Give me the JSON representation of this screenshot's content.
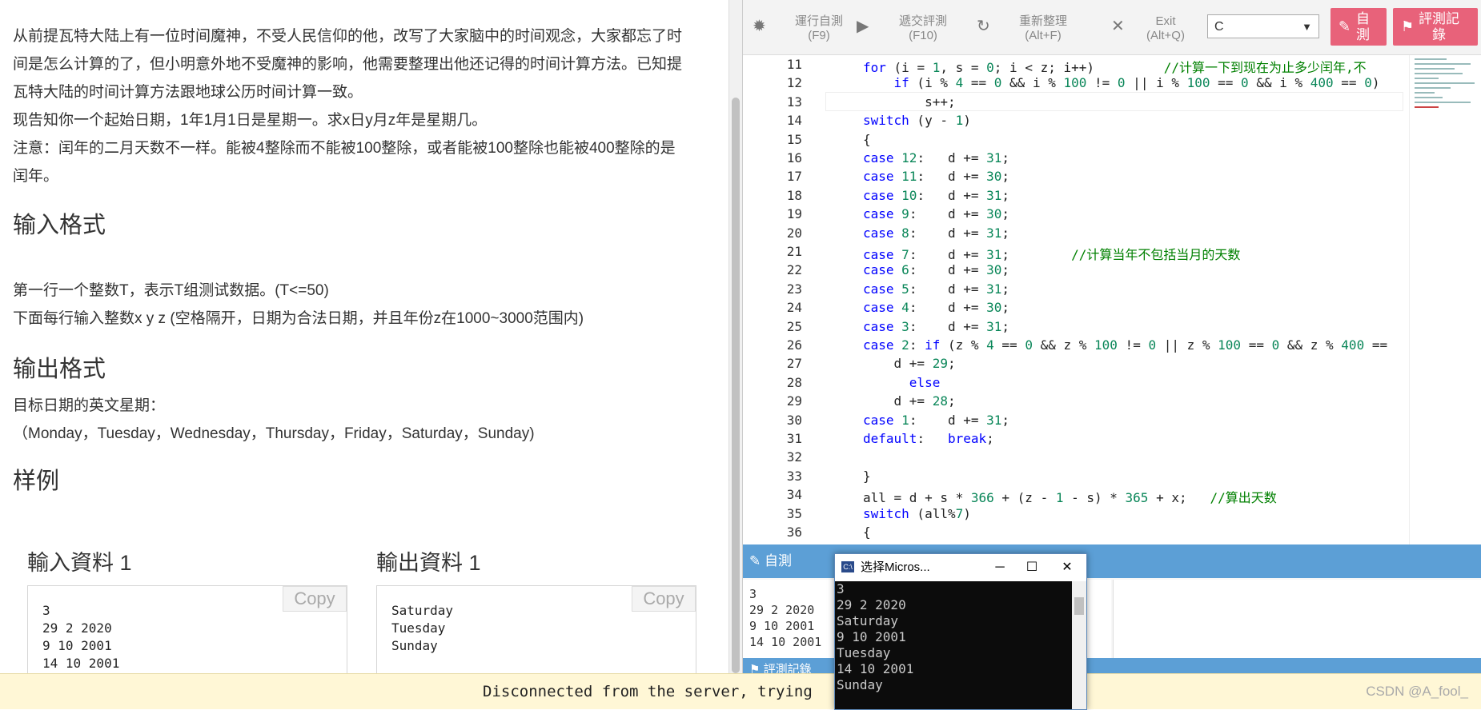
{
  "problem": {
    "paragraphs": [
      "从前提瓦特大陆上有一位时间魔神，不受人民信仰的他，改写了大家脑中的时间观念，大家都忘了时",
      "间是怎么计算的了，但小明意外地不受魔神的影响，他需要整理出他还记得的时间计算方法。已知提",
      "瓦特大陆的时间计算方法跟地球公历时间计算一致。",
      "现告知你一个起始日期，1年1月1日是星期一。求x日y月z年是星期几。",
      "注意：闰年的二月天数不一样。能被4整除而不能被100整除，或者能被100整除也能被400整除的是",
      "闰年。"
    ],
    "input_heading": "输入格式",
    "input_lines": [
      "第一行一个整数T，表示T组测试数据。(T<=50)",
      "下面每行输入整数x y z (空格隔开，日期为合法日期，并且年份z在1000~3000范围内)"
    ],
    "output_heading": "输出格式",
    "output_lines": [
      "目标日期的英文星期：",
      "（Monday，Tuesday，Wednesday，Thursday，Friday，Saturday，Sunday)"
    ],
    "sample_heading": "样例",
    "sample_input_title": "輸入資料 1",
    "sample_output_title": "輸出資料 1",
    "copy_label": "Copy",
    "sample_input": "3\n29 2 2020\n9 10 2001\n14 10 2001",
    "sample_output": "Saturday\nTuesday\nSunday"
  },
  "toolbar": {
    "run_label": "運行自測",
    "run_key": "(F9)",
    "submit_label": "遞交評測",
    "submit_key": "(F10)",
    "format_label": "重新整理",
    "format_key": "(Alt+F)",
    "exit_label": "Exit",
    "exit_key": "(Alt+Q)",
    "language": "C",
    "self_test_label_1": "自",
    "self_test_label_2": "測",
    "record_label_1": "評測記",
    "record_label_2": "錄"
  },
  "editor": {
    "line_numbers": [
      "11",
      "12",
      "13",
      "14",
      "15",
      "16",
      "17",
      "18",
      "19",
      "20",
      "21",
      "22",
      "23",
      "24",
      "25",
      "26",
      "27",
      "28",
      "29",
      "30",
      "31",
      "32",
      "33",
      "34",
      "35",
      "36"
    ]
  },
  "selftest": {
    "header": "自測",
    "input": "3\n29 2 2020\n9 10 2001\n14 10 2001",
    "history_label": "評測記錄"
  },
  "banner": {
    "text": "Disconnected from the server, trying"
  },
  "console": {
    "title": "选择Micros...",
    "output": "3\n29 2 2020\nSaturday\n9 10 2001\nTuesday\n14 10 2001\nSunday "
  },
  "watermark": "CSDN @A_fool_",
  "colors": {
    "accent_pink": "#e8627a",
    "panel_blue": "#5c9fd6",
    "keyword_blue": "#0000ff",
    "comment_green": "#008000",
    "banner_yellow": "#fff7d6"
  }
}
